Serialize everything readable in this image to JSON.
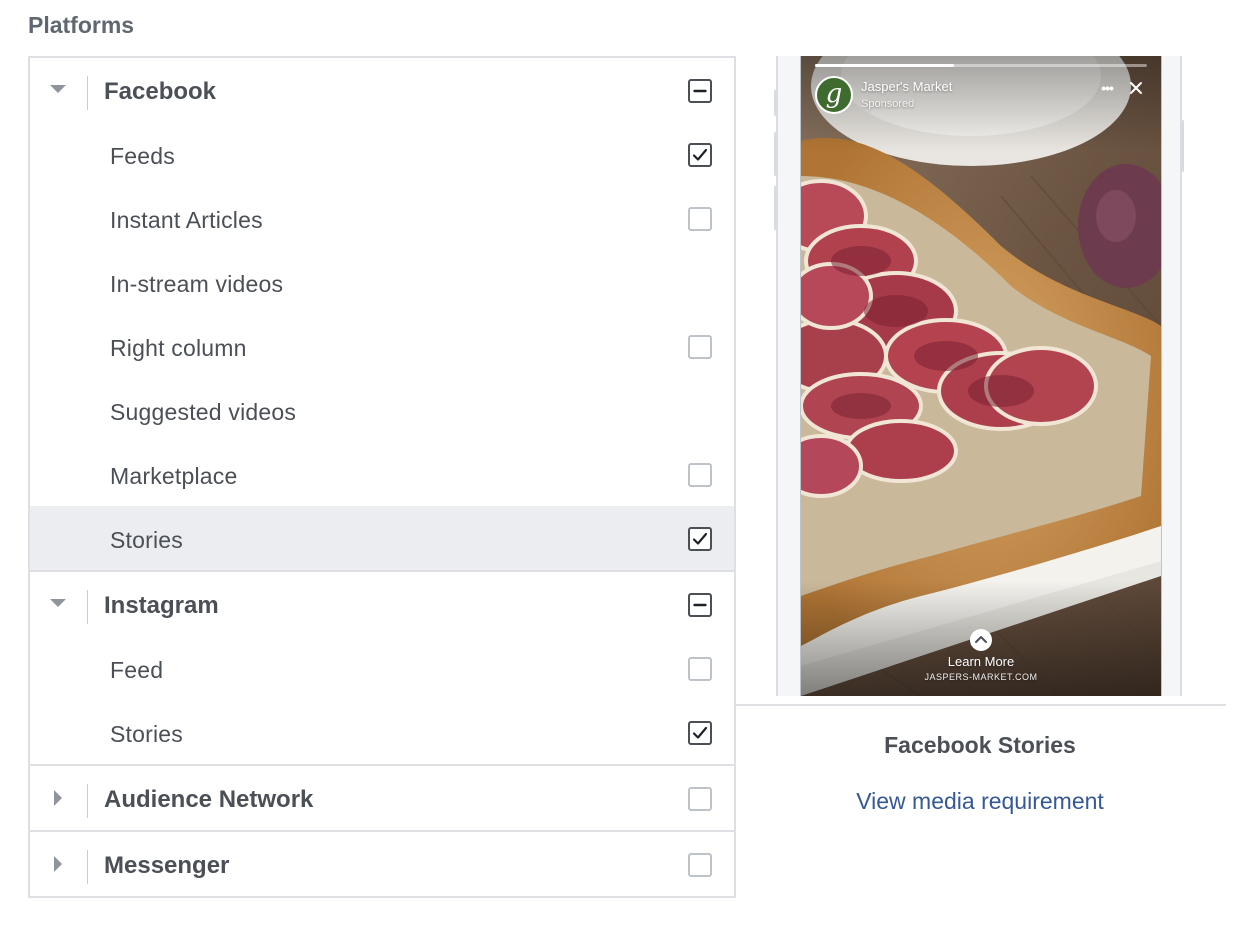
{
  "section_title": "Platforms",
  "colors": {
    "border": "#dddfe2",
    "highlight_row": "#ebedf0",
    "text_secondary": "#4b4f56",
    "link": "#365899"
  },
  "platforms": [
    {
      "name": "Facebook",
      "expanded": true,
      "state": "indeterminate",
      "placements": [
        {
          "label": "Feeds",
          "checkbox": "checked"
        },
        {
          "label": "Instant Articles",
          "checkbox": "unchecked"
        },
        {
          "label": "In-stream videos",
          "checkbox": "none"
        },
        {
          "label": "Right column",
          "checkbox": "unchecked"
        },
        {
          "label": "Suggested videos",
          "checkbox": "none"
        },
        {
          "label": "Marketplace",
          "checkbox": "unchecked"
        },
        {
          "label": "Stories",
          "checkbox": "checked",
          "highlighted": true
        }
      ]
    },
    {
      "name": "Instagram",
      "expanded": true,
      "state": "indeterminate",
      "placements": [
        {
          "label": "Feed",
          "checkbox": "unchecked"
        },
        {
          "label": "Stories",
          "checkbox": "checked"
        }
      ]
    },
    {
      "name": "Audience Network",
      "expanded": false,
      "state": "unchecked",
      "placements": []
    },
    {
      "name": "Messenger",
      "expanded": false,
      "state": "unchecked",
      "placements": []
    }
  ],
  "preview": {
    "brand_name": "Jasper's Market",
    "sponsored_label": "Sponsored",
    "avatar_letter": "g",
    "more_icon": "ellipsis-icon",
    "close_icon": "close-icon",
    "story_progress": 0.42,
    "cta_label": "Learn More",
    "cta_url": "JASPERS-MARKET.COM",
    "placement_title": "Facebook Stories",
    "media_link": "View media requirement"
  }
}
